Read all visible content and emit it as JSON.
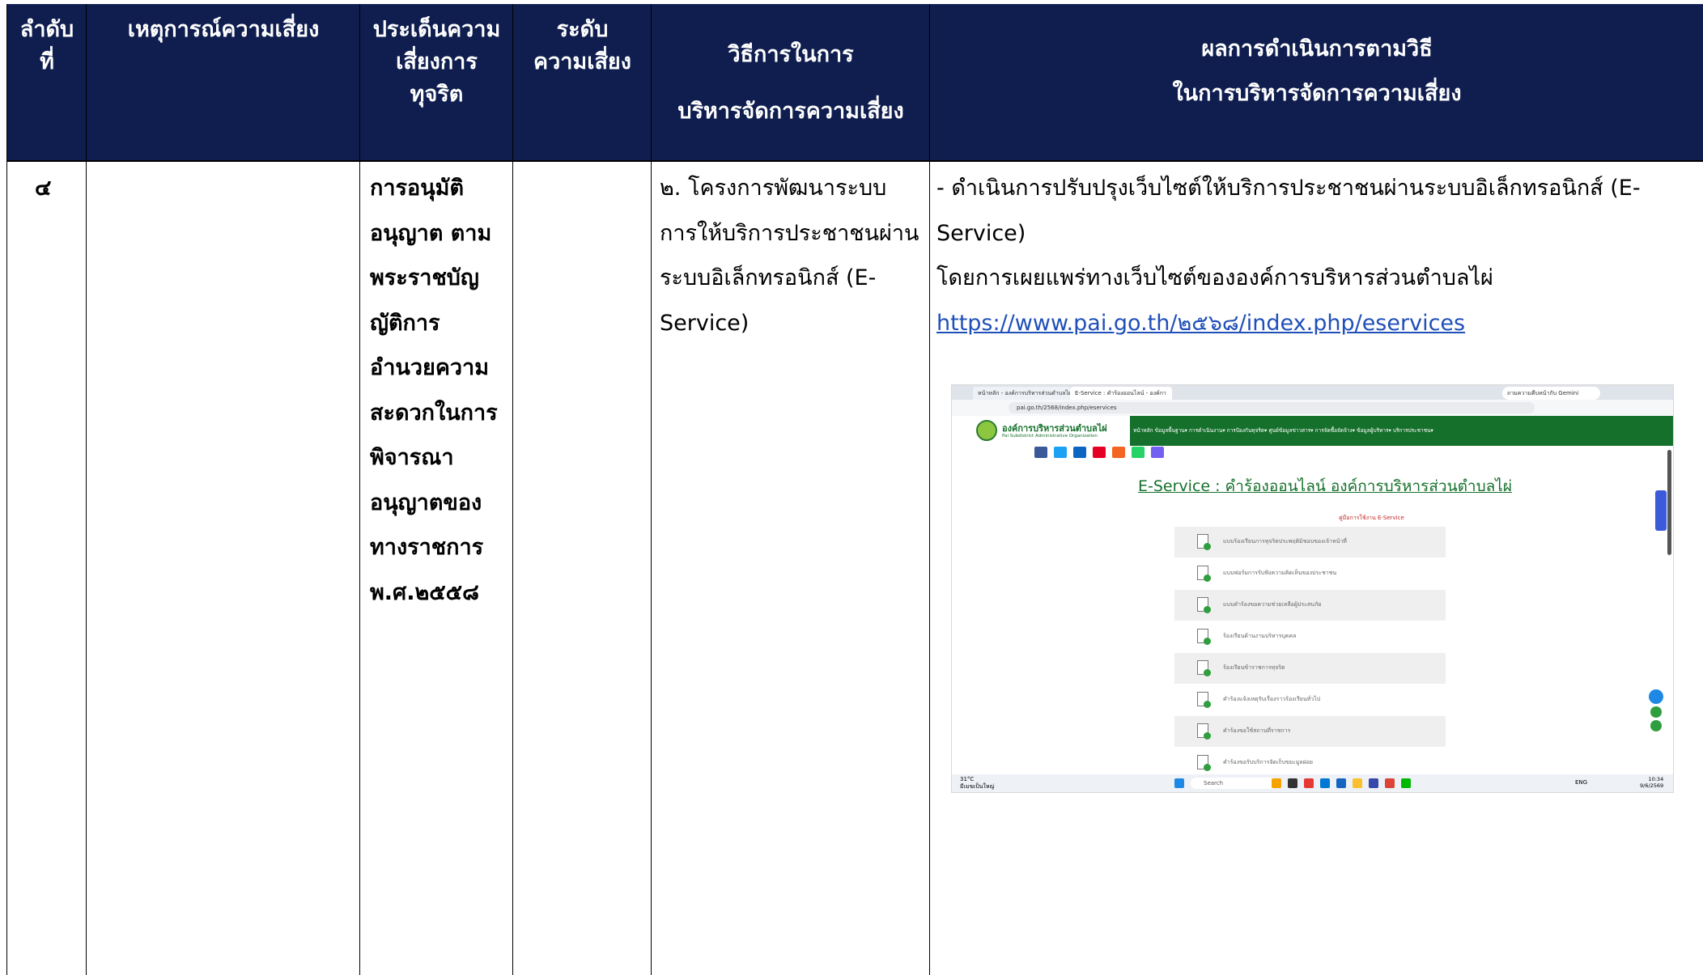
{
  "header": {
    "col1": [
      "ลำดับ",
      "ที่"
    ],
    "col2": "เหตุการณ์ความเสี่ยง",
    "col3": [
      "ประเด็นความ",
      "เสี่ยงการ",
      "ทุจริต"
    ],
    "col4": [
      "ระดับ",
      "ความเสี่ยง"
    ],
    "col5": [
      "วิธีการในการ",
      "บริหารจัดการความเสี่ยง"
    ],
    "col6": [
      "ผลการดำเนินการตามวิธี",
      "ในการบริหารจัดการความเสี่ยง"
    ]
  },
  "row": {
    "number": "๔",
    "issue_lines": [
      "การอนุมัติ",
      "อนุญาต ตาม",
      "พระราชบัญ",
      "ญัติการ",
      "อำนวยความ",
      "สะดวกในการ",
      "พิจารณา",
      "อนุญาตของ",
      "ทางราชการ",
      "พ.ศ.๒๕๕๘"
    ],
    "method_lines": [
      "๒. โครงการพัฒนาระบบ",
      "การให้บริการประชาชนผ่าน",
      "ระบบอิเล็กทรอนิกส์ (E-",
      "Service)"
    ],
    "result_lines": [
      "- ดำเนินการปรับปรุงเว็บไซต์ให้บริการประชาชนผ่านระบบอิเล็กทรอนิกส์ (E-",
      "Service)",
      "โดยการเผยแพร่ทางเว็บไซต์ขององค์การบริหารส่วนตำบลไผ่"
    ],
    "result_link": "https://www.pai.go.th/๒๕๖๘/index.php/eservices"
  },
  "screenshot": {
    "tab1": "หน้าหลัก - องค์การบริหารส่วนตำบลไผ่",
    "tab2": "E-Service : คำร้องออนไลน์ - องค์กา",
    "gemini": "ถามความคืบหน้ากับ Gemini",
    "url": "pai.go.th/2568/index.php/eservices",
    "org_name": "องค์การบริหารส่วนตำบลไผ่",
    "org_name_en": "Pai Subdistrict Administrative Organization",
    "nav": "หน้าหลัก  ข้อมูลพื้นฐาน▾  การดำเนินงาน▾  การป้องกันทุจริต▾  ศูนย์ข้อมูลข่าวสาร▾  การจัดซื้อจัดจ้าง▾  ข้อมูลผู้บริหาร▾  บริการประชาชน▾",
    "title": "E-Service : คำร้องออนไลน์ องค์การบริหารส่วนตำบลไผ่",
    "guide": "คู่มือการใช้งาน E-Service",
    "items": [
      "แบบร้องเรียนการทุจริตประพฤติมิชอบของเจ้าหน้าที่",
      "แบบฟอร์มการรับฟังความคิดเห็นของประชาชน",
      "แบบคำร้องขอความช่วยเหลือผู้ประสบภัย",
      "ร้องเรียนด้านงานบริหารบุคคล",
      "ร้องเรียนข้าราชการทุจริต",
      "คำร้องแจ้งเหตุรับเรื่องราวร้องเรียนทั่วไป",
      "คำร้องขอใช้สถานที่ราชการ",
      "คำร้องขอรับบริการจัดเก็บขยะมูลฝอย"
    ],
    "weather": "31°C",
    "weather_sub": "มีเมฆเป็นใหญ่",
    "search": "Search",
    "lang": "ENG",
    "time": "10:34",
    "date": "9/6/2569"
  }
}
